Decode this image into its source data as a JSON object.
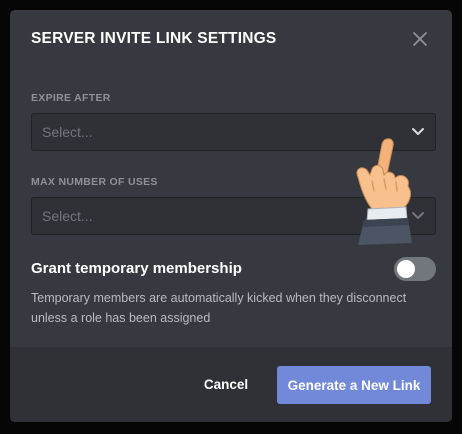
{
  "modal": {
    "title": "SERVER INVITE LINK SETTINGS",
    "close_icon": "close-icon"
  },
  "expire_after": {
    "label": "EXPIRE AFTER",
    "placeholder": "Select...",
    "chevron_icon": "chevron-down-icon"
  },
  "max_uses": {
    "label": "MAX NUMBER OF USES",
    "placeholder": "Select...",
    "chevron_icon": "chevron-down-icon"
  },
  "grant_membership": {
    "title": "Grant temporary membership",
    "description": "Temporary members are automatically kicked when they disconnect unless a role has been assigned",
    "toggle_on": false
  },
  "footer": {
    "cancel_label": "Cancel",
    "generate_label": "Generate a New Link"
  },
  "overlay": {
    "icon": "pointing-hand-icon"
  },
  "colors": {
    "modal_bg": "#36393f",
    "footer_bg": "#2f3136",
    "input_bg": "#2f3136",
    "accent": "#7289da",
    "label": "#8e9297",
    "placeholder": "#72767d",
    "description": "#b9bbbe",
    "toggle_off": "#72767d"
  }
}
